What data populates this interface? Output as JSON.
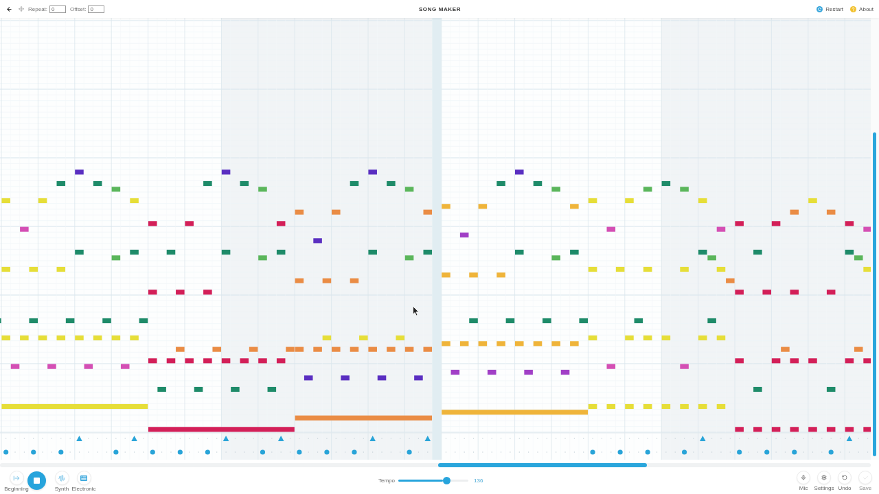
{
  "header": {
    "fields": [
      {
        "label": "Repeat:",
        "value": "0"
      },
      {
        "label": "Offset:",
        "value": "0"
      }
    ],
    "title": "SONG MAKER",
    "links": [
      {
        "kind": "restart",
        "label": "Restart"
      },
      {
        "kind": "about",
        "label": "About"
      }
    ]
  },
  "transport": {
    "playing": true,
    "buttons": [
      {
        "kind": "beginning",
        "label": "Beginning"
      },
      {
        "kind": "synth",
        "label": "Synth"
      },
      {
        "kind": "electronic",
        "label": "Electronic"
      }
    ]
  },
  "tempo": {
    "label": "Tempo",
    "level": 0.69,
    "reading": "136"
  },
  "tools": [
    {
      "kind": "mic",
      "label": "Mic",
      "disabled": false
    },
    {
      "kind": "settings",
      "label": "Settings",
      "disabled": false
    },
    {
      "kind": "undo",
      "label": "Undo",
      "disabled": false
    },
    {
      "kind": "save",
      "label": "Save",
      "disabled": true
    }
  ]
}
